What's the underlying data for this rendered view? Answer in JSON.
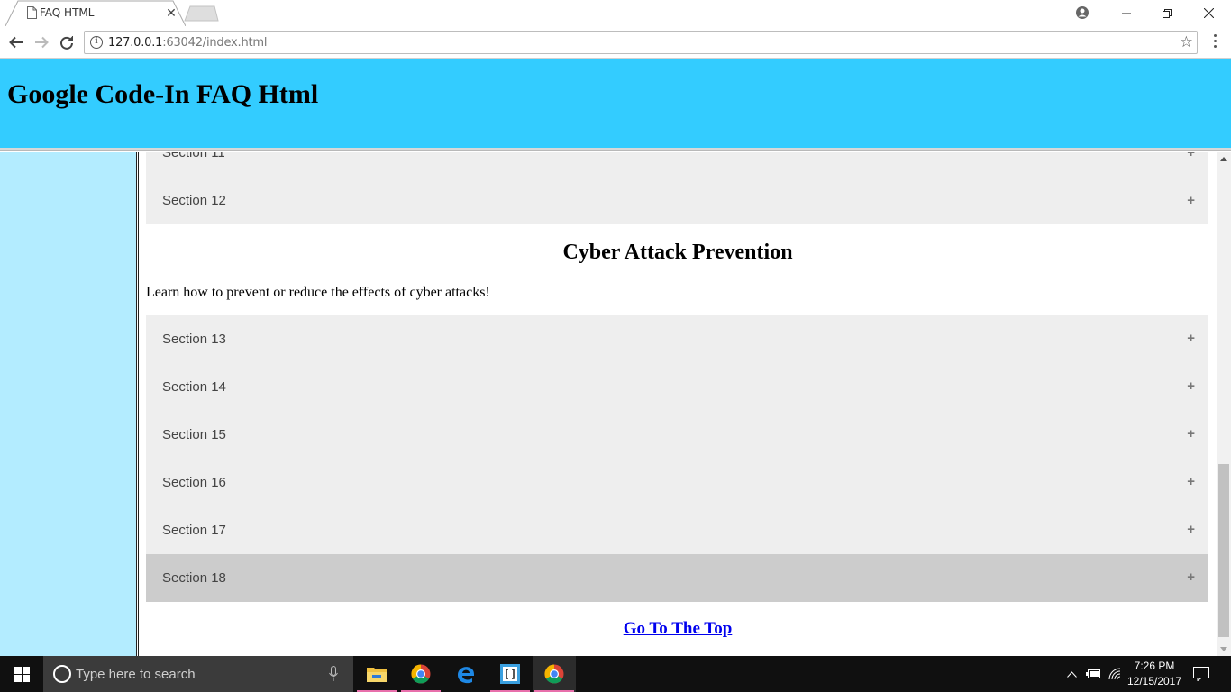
{
  "browser": {
    "tab_title": "FAQ HTML",
    "url_host": "127.0.0.1",
    "url_rest": ":63042/index.html"
  },
  "page": {
    "site_title": "Google Code-In FAQ Html",
    "partial_section_label": "Section 11",
    "section_12_label": "Section 12",
    "heading": "Cyber Attack Prevention",
    "description": "Learn how to prevent or reduce the effects of cyber attacks!",
    "sections": [
      {
        "label": "Section 13",
        "active": false
      },
      {
        "label": "Section 14",
        "active": false
      },
      {
        "label": "Section 15",
        "active": false
      },
      {
        "label": "Section 16",
        "active": false
      },
      {
        "label": "Section 17",
        "active": false
      },
      {
        "label": "Section 18",
        "active": true
      }
    ],
    "plus_symbol": "+",
    "top_link": "Go To The Top"
  },
  "taskbar": {
    "search_placeholder": "Type here to search",
    "time": "7:26 PM",
    "date": "12/15/2017"
  },
  "colors": {
    "header_bg": "#33ccff",
    "sidebar_bg": "#b3ecff",
    "accordion_bg": "#eeeeee",
    "accordion_active_bg": "#cccccc",
    "link": "#0000ee"
  }
}
